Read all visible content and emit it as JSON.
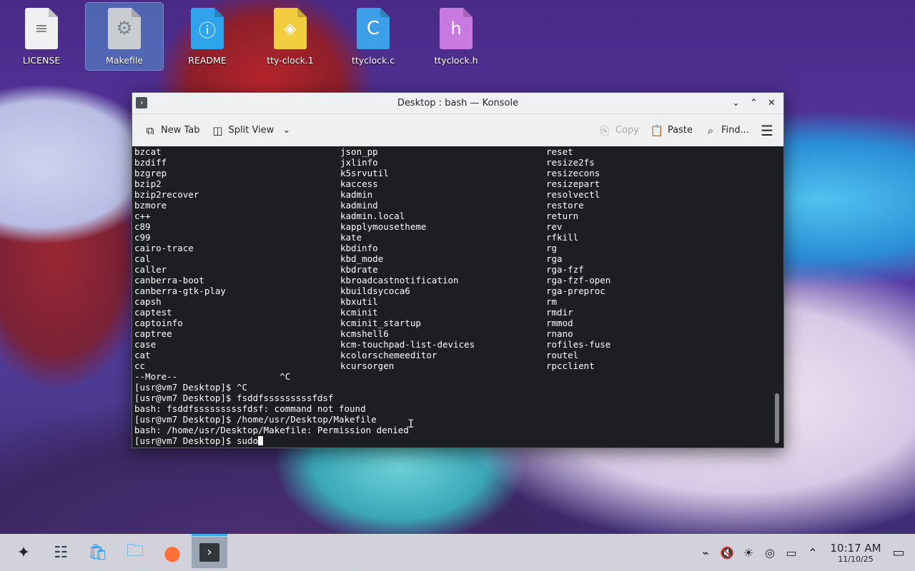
{
  "desktop": {
    "icons": [
      {
        "label": "LICENSE",
        "glyph": "≡",
        "icon": "text-file-icon"
      },
      {
        "label": "Makefile",
        "glyph": "⚙",
        "icon": "makefile-icon"
      },
      {
        "label": "README",
        "glyph": "ⓘ",
        "icon": "readme-info-icon"
      },
      {
        "label": "tty-clock.1",
        "glyph": "◈",
        "icon": "manpage-file-icon"
      },
      {
        "label": "ttyclock.c",
        "glyph": "C",
        "icon": "c-source-file-icon"
      },
      {
        "label": "ttyclock.h",
        "glyph": "h",
        "icon": "c-header-file-icon"
      }
    ]
  },
  "window": {
    "title": "Desktop : bash — Konsole",
    "app_glyph": "›",
    "controls": {
      "minimize": "⌄",
      "maximize": "⌃",
      "close": "✕"
    }
  },
  "toolbar": {
    "new_tab": "New Tab",
    "split_view": "Split View",
    "copy": "Copy",
    "paste": "Paste",
    "find": "Find...",
    "menu_glyph": "☰"
  },
  "terminal": {
    "col1": [
      "bzcat",
      "bzdiff",
      "bzgrep",
      "bzip2",
      "bzip2recover",
      "bzmore",
      "c++",
      "c89",
      "c99",
      "cairo-trace",
      "cal",
      "caller",
      "canberra-boot",
      "canberra-gtk-play",
      "capsh",
      "captest",
      "captoinfo",
      "captree",
      "case",
      "cat",
      "cc"
    ],
    "col2": [
      "json_pp",
      "jxlinfo",
      "k5srvutil",
      "kaccess",
      "kadmin",
      "kadmind",
      "kadmin.local",
      "kapplymousetheme",
      "kate",
      "kbdinfo",
      "kbd_mode",
      "kbdrate",
      "kbroadcastnotification",
      "kbuildsycoca6",
      "kbxutil",
      "kcminit",
      "kcminit_startup",
      "kcmshell6",
      "kcm-touchpad-list-devices",
      "kcolorschemeeditor",
      "kcursorgen"
    ],
    "col3": [
      "reset",
      "resize2fs",
      "resizecons",
      "resizepart",
      "resolvectl",
      "restore",
      "return",
      "rev",
      "rfkill",
      "rg",
      "rga",
      "rga-fzf",
      "rga-fzf-open",
      "rga-preproc",
      "rm",
      "rmdir",
      "rmmod",
      "rnano",
      "rofiles-fuse",
      "routel",
      "rpcclient"
    ],
    "tail": [
      "--More--                   ^C",
      "[usr@vm7 Desktop]$ ^C",
      "[usr@vm7 Desktop]$ fsddfsssssssssfdsf",
      "bash: fsddfsssssssssfdsf: command not found",
      "[usr@vm7 Desktop]$ /home/usr/Desktop/Makefile",
      "bash: /home/usr/Desktop/Makefile: Permission denied"
    ],
    "prompt": "[usr@vm7 Desktop]$ sudo"
  },
  "panel": {
    "tasks": [
      {
        "name": "application-launcher-icon",
        "glyph": "✦"
      },
      {
        "name": "system-settings-icon",
        "glyph": "☷"
      },
      {
        "name": "discover-store-icon",
        "glyph": "🛍"
      },
      {
        "name": "file-manager-icon",
        "glyph": "🗀"
      },
      {
        "name": "firefox-icon",
        "glyph": "●"
      },
      {
        "name": "konsole-icon",
        "glyph": "›"
      }
    ],
    "tray": [
      "⌁",
      "🔇",
      "☀",
      "◎",
      "▭",
      "⌃"
    ],
    "time": "10:17 AM",
    "date": "11/10/25",
    "show_desktop_glyph": "▭"
  }
}
